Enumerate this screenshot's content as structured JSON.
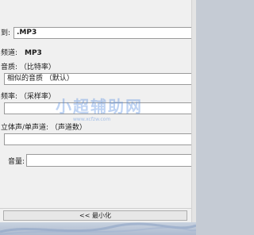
{
  "output": {
    "label": "到:",
    "value": ".MP3"
  },
  "channel": {
    "label": "频道:",
    "value": "MP3"
  },
  "quality": {
    "label": "音质: （比特率）",
    "value": "相似的音质 （默认）"
  },
  "samplerate": {
    "label": "频率: （采样率）",
    "value": ""
  },
  "stereo": {
    "label": "立体声/单声道: （声道数）",
    "value": ""
  },
  "volume": {
    "label": "音量:",
    "value": ""
  },
  "collapse_button": {
    "label": "<< 最小化"
  },
  "watermark": {
    "text": "小超辅助网",
    "url": "www.xcfzw.com"
  }
}
